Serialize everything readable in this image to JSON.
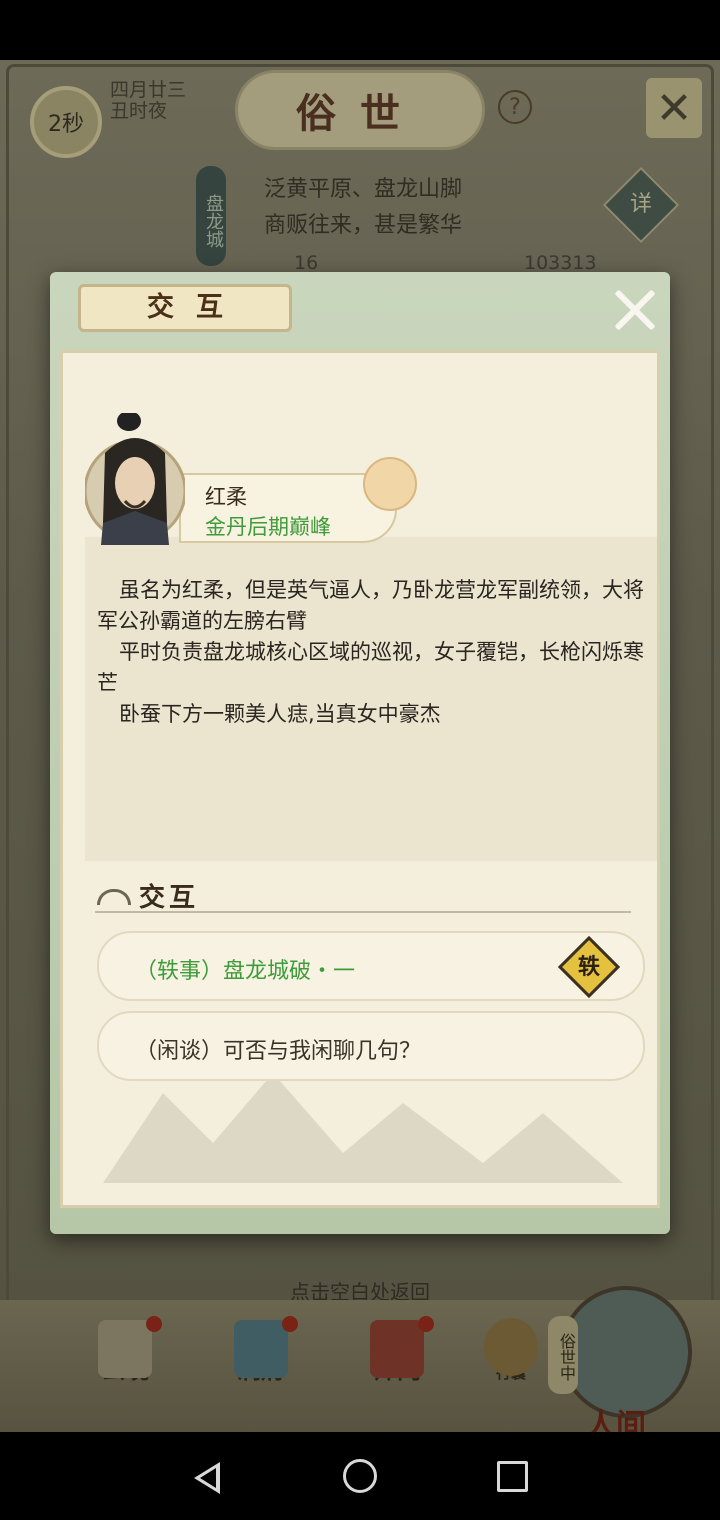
{
  "background": {
    "timer": "2秒",
    "date_line1": "四月廿三",
    "date_line2": "丑时夜",
    "title": "俗世",
    "help_label": "?",
    "location_tag": "盘龙城",
    "location_line1": "泛黄平原、盘龙山脚",
    "location_line2": "商贩往来，甚是繁华",
    "detail_label": "详",
    "stat1": "16",
    "stat2": "103313"
  },
  "dialog": {
    "title": "交互",
    "character": {
      "name": "红柔",
      "rank": "金丹后期巅峰"
    },
    "description": [
      "虽名为红柔，但是英气逼人，乃卧龙营龙军副统领，大将军公孙霸道的左膀右臂",
      "平时负责盘龙城核心区域的巡视，女子覆铠，长枪闪烁寒芒",
      "卧蚕下方一颗美人痣,当真女中豪杰"
    ],
    "section_label": "交互",
    "options": [
      {
        "label": "（轶事）盘龙城破・一",
        "badge": "轶"
      },
      {
        "label": "（闲谈）可否与我闲聊几句？"
      }
    ]
  },
  "hint": "点击空白处返回",
  "nav": {
    "items": [
      "玄境",
      "洞府",
      "师门",
      "行囊"
    ],
    "world_tag": "俗世中",
    "world_label": "人间"
  },
  "colors": {
    "option_story": "#3e9d3a",
    "rank": "#3f9a3a",
    "badge": "#e4c13e"
  }
}
